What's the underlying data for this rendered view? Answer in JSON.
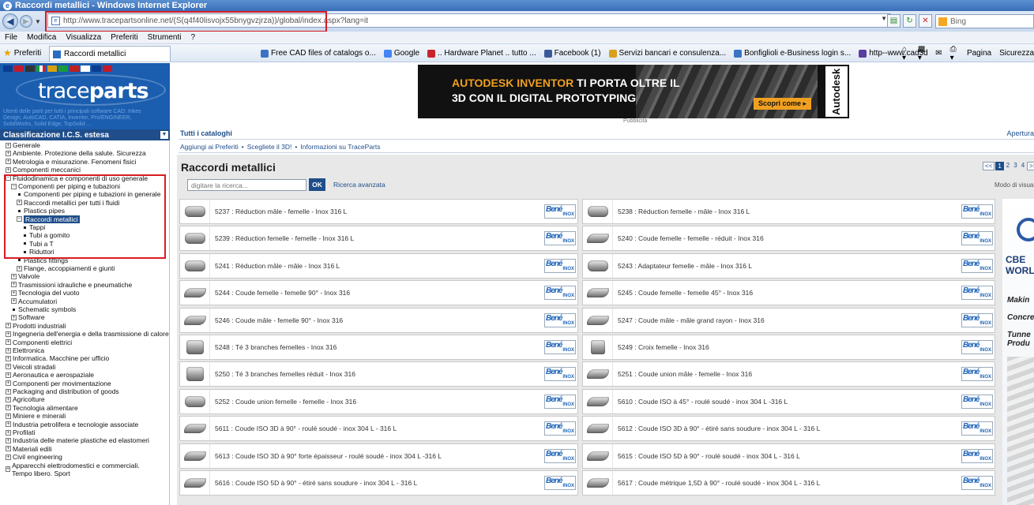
{
  "window": {
    "title": "Raccordi metallici - Windows Internet Explorer"
  },
  "address_bar": {
    "url": "http://www.tracepartsonline.net/(S(q4f40lisvojx55bnygvzjrza))/global/index.aspx?lang=it",
    "search_placeholder": "Bing"
  },
  "menu": [
    "File",
    "Modifica",
    "Visualizza",
    "Preferiti",
    "Strumenti",
    "?"
  ],
  "favorites_bar": {
    "preferiti_label": "Preferiti",
    "active_tab": "Raccordi metallici",
    "links": [
      {
        "label": "Free CAD files of catalogs o...",
        "color": "#3b73c4"
      },
      {
        "label": "Google",
        "color": "#4285f4"
      },
      {
        "label": ".. Hardware Planet .. tutto ...",
        "color": "#c8242a"
      },
      {
        "label": "Facebook (1)",
        "color": "#3b5998"
      },
      {
        "label": "Servizi bancari e consulenza...",
        "color": "#d9a020"
      },
      {
        "label": "Bonfiglioli e-Business login s...",
        "color": "#3b73c4"
      },
      {
        "label": "http--www.cad3d",
        "color": "#5a3fa0"
      }
    ],
    "command_items": [
      "Pagina",
      "Sicurezza"
    ]
  },
  "sidebar": {
    "logo_light": "trace",
    "logo_bold": "parts",
    "tagline": "Utenti delle parti per tutti i principali software CAD: Inkes Design, AutoCAD, CATIA, Inventor, Pro/ENGINEER, SolidWorks, Solid Edge, TopSolid ...",
    "class_header": "Classificazione I.C.S. estesa",
    "tree": [
      {
        "label": "Generale",
        "indent": 0,
        "kind": "plus"
      },
      {
        "label": "Ambiente. Protezione della salute. Sicurezza",
        "indent": 0,
        "kind": "plus"
      },
      {
        "label": "Metrologia e misurazione. Fenomeni fisici",
        "indent": 0,
        "kind": "plus"
      },
      {
        "label": "Componenti meccanici",
        "indent": 0,
        "kind": "plus"
      },
      {
        "label": "Fluidodinamica e componenti di uso generale",
        "indent": 0,
        "kind": "minus"
      },
      {
        "label": "Componenti per piping e tubazioni",
        "indent": 1,
        "kind": "minus"
      },
      {
        "label": "Componenti per piping e tubazioni in generale",
        "indent": 2,
        "kind": "bullet"
      },
      {
        "label": "Raccordi metallici per tutti i fluidi",
        "indent": 2,
        "kind": "plus"
      },
      {
        "label": "Plastics pipes",
        "indent": 2,
        "kind": "bullet"
      },
      {
        "label": "Raccordi metallici",
        "indent": 2,
        "kind": "minus",
        "selected": true
      },
      {
        "label": "Tappi",
        "indent": 3,
        "kind": "bullet"
      },
      {
        "label": "Tubi a gomito",
        "indent": 3,
        "kind": "bullet"
      },
      {
        "label": "Tubi a T",
        "indent": 3,
        "kind": "bullet"
      },
      {
        "label": "Riduttori",
        "indent": 3,
        "kind": "bullet"
      },
      {
        "label": "Plastics fittings",
        "indent": 2,
        "kind": "bullet"
      },
      {
        "label": "Flange, accoppiamenti e giunti",
        "indent": 2,
        "kind": "plus"
      },
      {
        "label": "Valvole",
        "indent": 1,
        "kind": "plus"
      },
      {
        "label": "Trasmissioni idrauliche e pneumatiche",
        "indent": 1,
        "kind": "plus"
      },
      {
        "label": "Tecnologia del vuoto",
        "indent": 1,
        "kind": "plus"
      },
      {
        "label": "Accumulatori",
        "indent": 1,
        "kind": "plus"
      },
      {
        "label": "Schematic symbols",
        "indent": 1,
        "kind": "bullet"
      },
      {
        "label": "Software",
        "indent": 1,
        "kind": "plus"
      },
      {
        "label": "Prodotti industriali",
        "indent": 0,
        "kind": "plus"
      },
      {
        "label": "Ingegneria dell'energia e della trasmissione di calore",
        "indent": 0,
        "kind": "plus"
      },
      {
        "label": "Componenti elettrici",
        "indent": 0,
        "kind": "plus"
      },
      {
        "label": "Elettronica",
        "indent": 0,
        "kind": "plus"
      },
      {
        "label": "Informatica. Macchine per ufficio",
        "indent": 0,
        "kind": "plus"
      },
      {
        "label": "Veicoli stradali",
        "indent": 0,
        "kind": "plus"
      },
      {
        "label": "Aeronautica e aerospaziale",
        "indent": 0,
        "kind": "plus"
      },
      {
        "label": "Componenti per movimentazione",
        "indent": 0,
        "kind": "plus"
      },
      {
        "label": "Packaging and distribution of goods",
        "indent": 0,
        "kind": "plus"
      },
      {
        "label": "Agricolture",
        "indent": 0,
        "kind": "plus"
      },
      {
        "label": "Tecnologia alimentare",
        "indent": 0,
        "kind": "plus"
      },
      {
        "label": "Miniere e minerali",
        "indent": 0,
        "kind": "plus"
      },
      {
        "label": "Industria petrolifera e tecnologie associate",
        "indent": 0,
        "kind": "plus"
      },
      {
        "label": "Profilati",
        "indent": 0,
        "kind": "plus"
      },
      {
        "label": "Industria delle materie plastiche ed elastomeri",
        "indent": 0,
        "kind": "plus"
      },
      {
        "label": "Materiali edili",
        "indent": 0,
        "kind": "plus"
      },
      {
        "label": "Civil engineering",
        "indent": 0,
        "kind": "plus"
      },
      {
        "label": "Apparecchi elettrodomestici e commerciali. Tempo libero. Sport",
        "indent": 0,
        "kind": "plus",
        "wrap": true
      }
    ]
  },
  "banner": {
    "line1_brand": "AUTODESK INVENTOR",
    "line1_rest": " TI PORTA OLTRE IL",
    "line2": "3D CON IL DIGITAL PROTOTYPING",
    "button": "Scopri come",
    "brand": "Autodesk",
    "caption": "Pubblicità"
  },
  "main": {
    "all_catalogs": "Tutti i cataloghi",
    "apertura": "Apertura",
    "quicklinks": [
      "Aggiungi ai Preferiti",
      "Scegliete il 3D!",
      "Informazioni su TraceParts"
    ],
    "page_title": "Raccordi metallici",
    "pager": {
      "prev": "<<",
      "pages": [
        "1",
        "2",
        "3",
        "4"
      ],
      "current": "1",
      "next": ">>"
    },
    "search_placeholder": "digitare la ricerca...",
    "ok_label": "OK",
    "advanced_search": "Ricerca avanzata",
    "view_mode": "Modo di visualizzazione",
    "supplier_logo_top": "Bené",
    "supplier_logo_bottom": "INOX",
    "products_left": [
      {
        "label": "5237 : Réduction mâle - femelle - Inox 316 L",
        "shape": "fitting"
      },
      {
        "label": "5239 : Réduction femelle - femelle - Inox 316 L",
        "shape": "fitting"
      },
      {
        "label": "5241 : Réduction mâle - mâle - Inox 316 L",
        "shape": "fitting"
      },
      {
        "label": "5244 : Coude femelle - femelle 90° - Inox 316",
        "shape": "elbow"
      },
      {
        "label": "5246 : Coude mâle - femelle 90° - Inox 316",
        "shape": "elbow"
      },
      {
        "label": "5248 : Té 3 branches femelles - Inox 316",
        "shape": "tee"
      },
      {
        "label": "5250 : Té 3 branches femelles réduit - Inox 316",
        "shape": "tee"
      },
      {
        "label": "5252 : Coude union femelle - femelle - Inox 316",
        "shape": "fitting"
      },
      {
        "label": "5611 : Coude ISO 3D à 90° - roulé soudé - inox 304 L - 316 L",
        "shape": "elbow"
      },
      {
        "label": "5613 : Coude ISO 3D à 90° forte épaisseur - roulé soudé - inox 304 L -316 L",
        "shape": "elbow"
      },
      {
        "label": "5616 : Coude ISO 5D à 90° - étiré sans soudure - inox 304 L - 316 L",
        "shape": "elbow"
      }
    ],
    "products_right": [
      {
        "label": "5238 : Réduction femelle - mâle - Inox 316 L",
        "shape": "fitting"
      },
      {
        "label": "5240 : Coude femelle - femelle - réduit - Inox 316",
        "shape": "elbow"
      },
      {
        "label": "5243 : Adaptateur femelle - mâle - Inox 316 L",
        "shape": "fitting"
      },
      {
        "label": "5245 : Coude femelle - femelle 45° - Inox 316",
        "shape": "elbow"
      },
      {
        "label": "5247 : Coude mâle - mâle grand rayon - Inox 316",
        "shape": "elbow"
      },
      {
        "label": "5249 : Croix femelle - Inox 316",
        "shape": "cross"
      },
      {
        "label": "5251 : Coude union mâle - femelle - Inox 316",
        "shape": "elbow"
      },
      {
        "label": "5610 : Coude ISO à 45° - roulé soudé - inox 304 L -316 L",
        "shape": "elbow"
      },
      {
        "label": "5612 : Coude ISO 3D à 90° - étiré sans soudure - inox 304 L - 316 L",
        "shape": "elbow"
      },
      {
        "label": "5615 : Coude ISO 5D à 90° - roulé soudé - inox 304 L - 316 L",
        "shape": "elbow"
      },
      {
        "label": "5617 : Coude métrique 1,5D à 90° - roulé soudé - inox 304 L - 316 L",
        "shape": "elbow"
      }
    ]
  },
  "right_ad": {
    "lines": [
      "CBE",
      "WORL"
    ],
    "italic": [
      "Makin",
      "Concre",
      "Tunne",
      "Produ"
    ]
  },
  "colors": {
    "accent": "#1f4e8a",
    "highlight": "#d81c24",
    "logo_bg": "#1b5eb0"
  }
}
